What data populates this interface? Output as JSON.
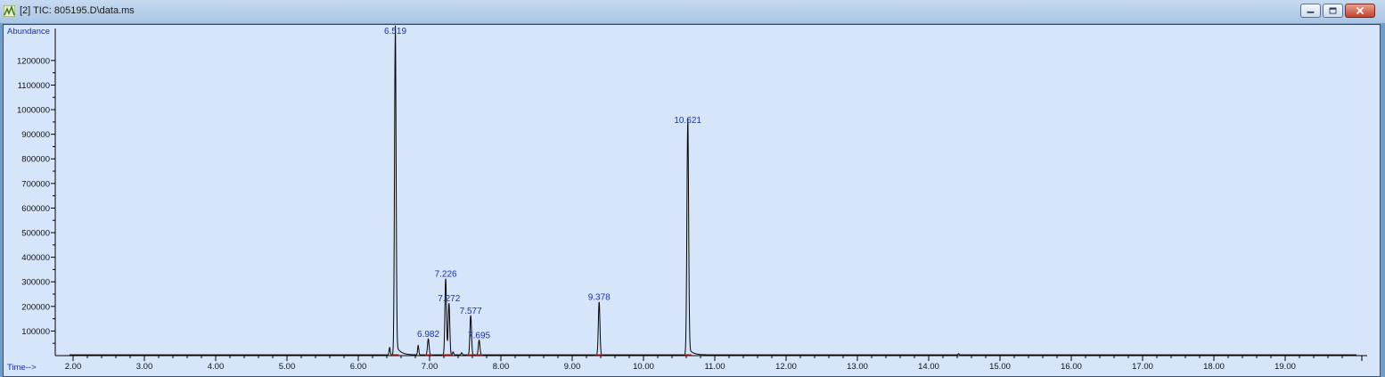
{
  "window": {
    "title": "[2] TIC: 805195.D\\data.ms",
    "icon": "chromatogram-app-icon",
    "buttons": [
      "minimize-icon",
      "maximize-icon",
      "close-icon"
    ]
  },
  "colors": {
    "plot_background": "#d6e5fa",
    "trace": "#000000",
    "labels": "#1a2fb8",
    "baseline_marks": "#e02020"
  },
  "chart_data": {
    "type": "line",
    "ylabel": "Abundance",
    "xlabel": "Time-->",
    "xlim": [
      1.75,
      20.15
    ],
    "ylim": [
      0,
      1330000
    ],
    "x_ticks": [
      "2.00",
      "3.00",
      "4.00",
      "5.00",
      "6.00",
      "7.00",
      "8.00",
      "9.00",
      "10.00",
      "11.00",
      "12.00",
      "13.00",
      "14.00",
      "15.00",
      "16.00",
      "17.00",
      "18.00",
      "19.00"
    ],
    "y_ticks": [
      "100000",
      "200000",
      "300000",
      "400000",
      "500000",
      "600000",
      "700000",
      "800000",
      "900000",
      "1000000",
      "1100000",
      "1200000"
    ],
    "grid": false,
    "peaks": [
      {
        "time": 6.519,
        "label": "6.519",
        "abundance": 1300000
      },
      {
        "time": 6.982,
        "label": "6.982",
        "abundance": 65000
      },
      {
        "time": 7.226,
        "label": "7.226",
        "abundance": 310000
      },
      {
        "time": 7.272,
        "label": "7.272",
        "abundance": 210000
      },
      {
        "time": 7.577,
        "label": "7.577",
        "abundance": 160000
      },
      {
        "time": 7.695,
        "label": "7.695",
        "abundance": 60000
      },
      {
        "time": 9.378,
        "label": "9.378",
        "abundance": 215000
      },
      {
        "time": 10.621,
        "label": "10.621",
        "abundance": 935000
      }
    ],
    "minor_peaks": [
      {
        "time": 6.44,
        "abundance": 30000
      },
      {
        "time": 6.84,
        "abundance": 38000
      },
      {
        "time": 7.33,
        "abundance": 12000
      },
      {
        "time": 7.45,
        "abundance": 9000
      },
      {
        "time": 14.42,
        "abundance": 5000
      }
    ],
    "baseline_abundance": 3000
  }
}
